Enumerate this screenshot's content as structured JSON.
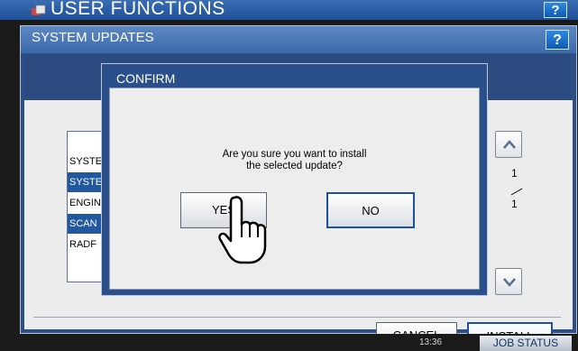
{
  "app": {
    "title": "USER FUNCTIONS",
    "help_label": "?"
  },
  "system_updates": {
    "title": "SYSTEM UPDATES",
    "help_label": "?",
    "list": [
      {
        "label": "SYSTE",
        "selected": false
      },
      {
        "label": "SYSTE",
        "selected": true
      },
      {
        "label": "ENGIN",
        "selected": false
      },
      {
        "label": "SCAN",
        "selected": true
      },
      {
        "label": "RADF",
        "selected": false
      }
    ],
    "page": {
      "current": "1",
      "total": "1"
    },
    "cancel_label": "CANCEL",
    "install_label": "INSTALL"
  },
  "confirm": {
    "title": "CONFIRM",
    "message_line1": "Are you sure you want to install",
    "message_line2": "the selected update?",
    "yes_label": "YES",
    "no_label": "NO"
  },
  "status_bar": {
    "time": "13:36",
    "job_status_label": "JOB STATUS"
  },
  "colors": {
    "title_blue": "#1e4f98",
    "selected_row": "#22589f",
    "dialog_bg": "#2a4f8a"
  }
}
